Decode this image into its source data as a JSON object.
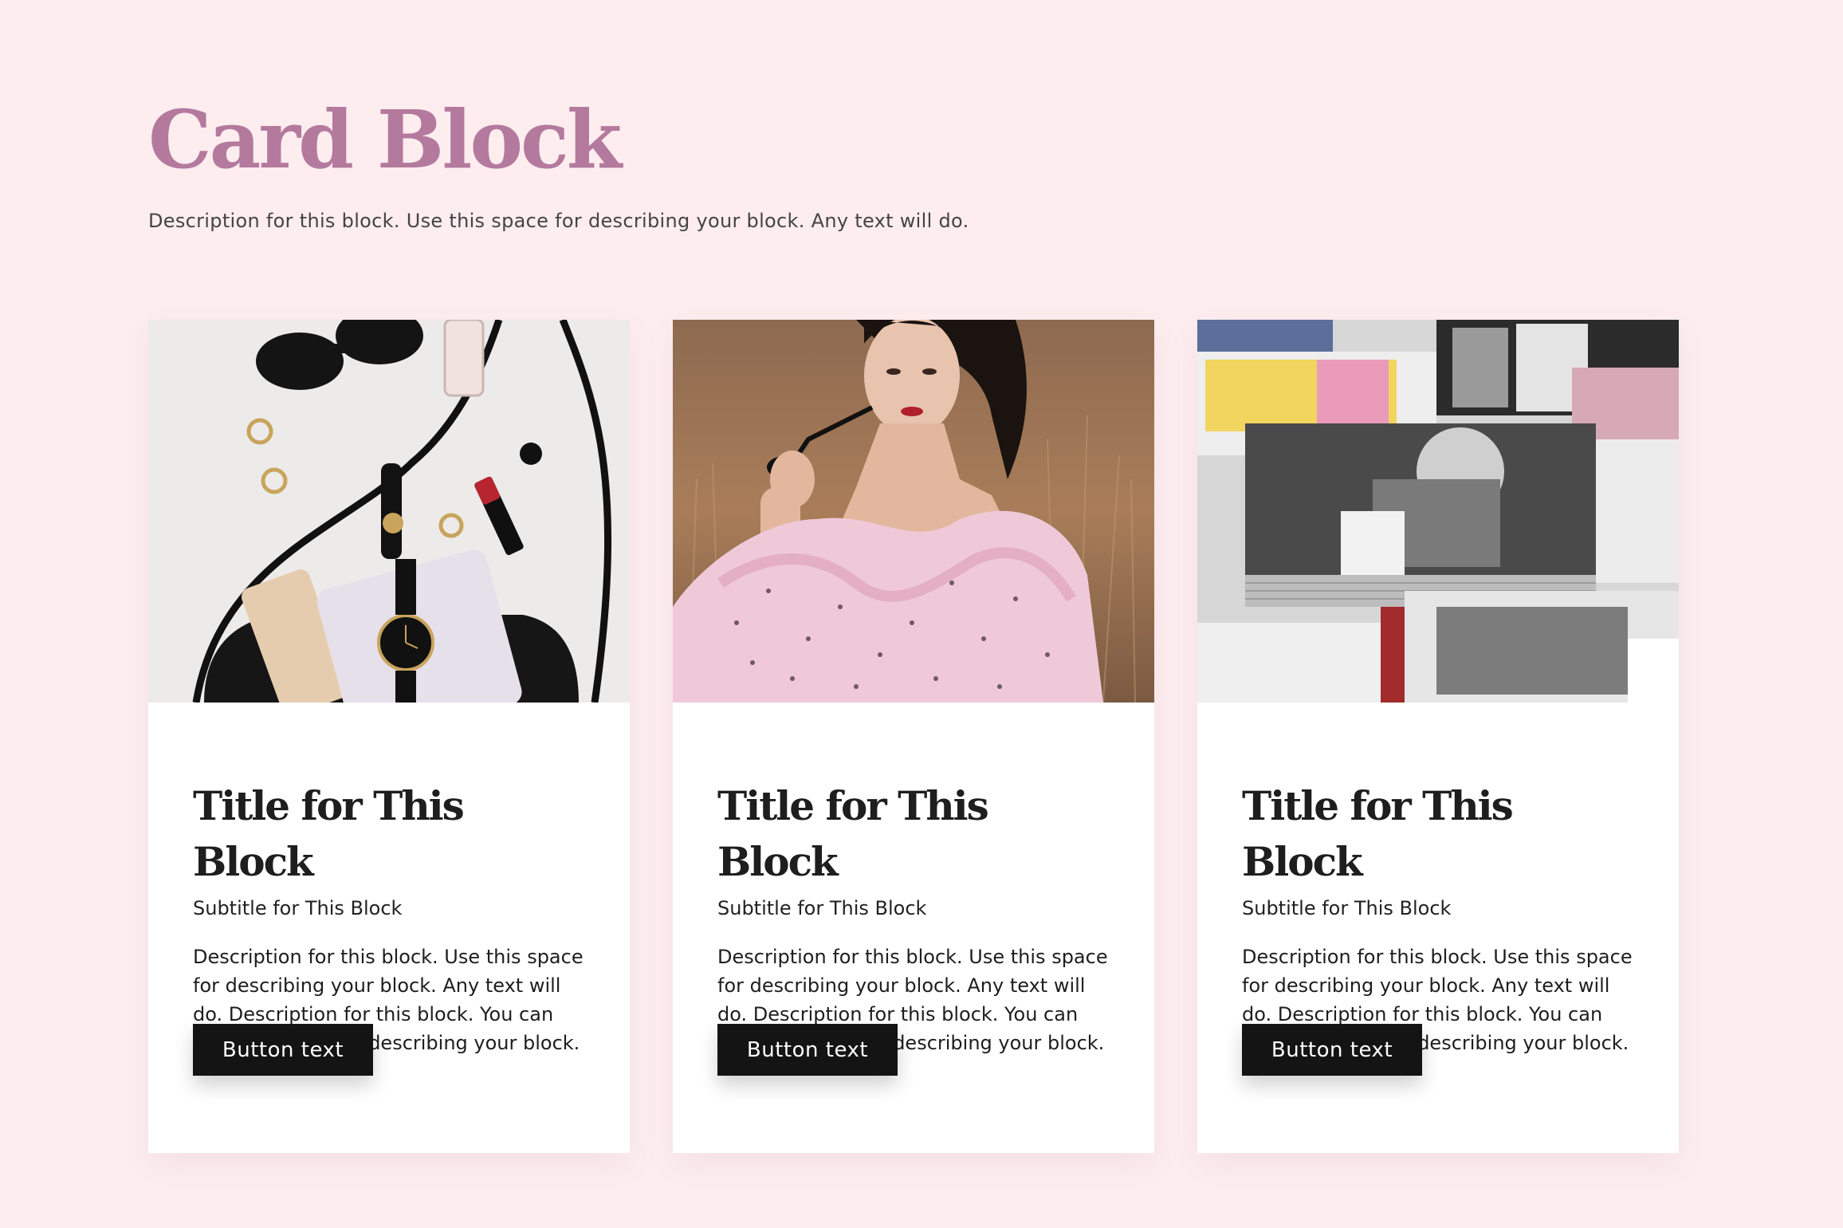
{
  "header": {
    "title": "Card Block",
    "description": "Description for this block. Use this space for describing your block. Any text will do."
  },
  "cards": [
    {
      "image_subject": "flat-lay of handbag, watch, phone, sunglasses and lipstick",
      "title": "Title for This Block",
      "subtitle": "Subtitle for This Block",
      "description": "Description for this block. Use this space for describing your block. Any text will do. Description for this block. You can use this space for describing your block.",
      "button_label": "Button text"
    },
    {
      "image_subject": "woman in pink polka-dot ruffled dress holding sunglasses in a field",
      "title": "Title for This Block",
      "subtitle": "Subtitle for This Block",
      "description": "Description for this block. Use this space for describing your block. Any text will do. Description for this block. You can use this space for describing your block.",
      "button_label": "Button text"
    },
    {
      "image_subject": "stacks of fashion magazines on a newsstand",
      "title": "Title for This Block",
      "subtitle": "Subtitle for This Block",
      "description": "Description for this block. Use this space for describing your block. Any text will do. Description for this block. You can use this space for describing your block.",
      "button_label": "Button text"
    }
  ],
  "colors": {
    "background": "#fdedef",
    "title_accent": "#b47a9d",
    "button": "#141414",
    "card": "#ffffff"
  }
}
